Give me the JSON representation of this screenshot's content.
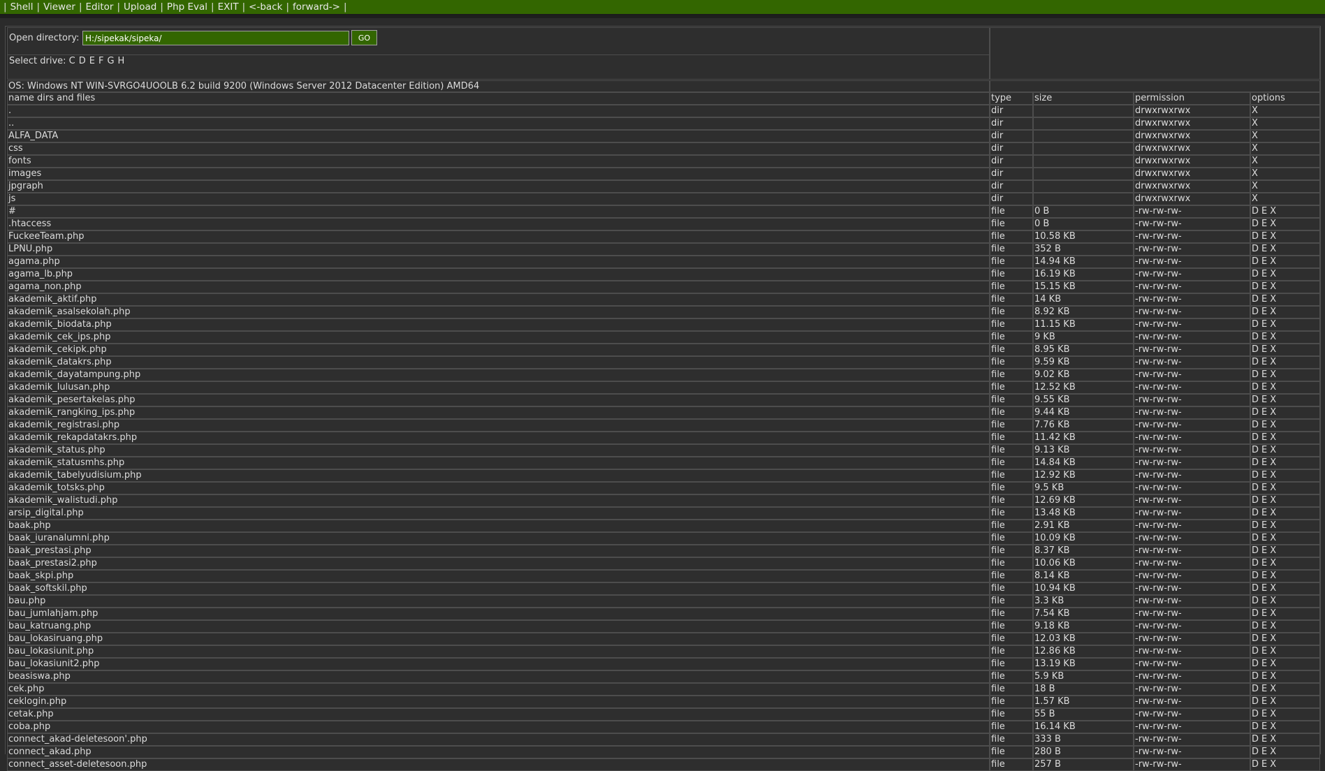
{
  "nav": {
    "items": [
      "Shell",
      "Viewer",
      "Editor",
      "Upload",
      "Php Eval",
      "EXIT",
      "<-back",
      "forward->"
    ]
  },
  "open_directory": {
    "label": "Open directory:",
    "value": "H:/sipekak/sipeka/",
    "go_label": "GO"
  },
  "drives": {
    "label": "Select drive:",
    "letters": [
      "C",
      "D",
      "E",
      "F",
      "G",
      "H"
    ]
  },
  "os_info": "OS: Windows NT WIN-SVRGO4UOOLB 6.2 build 9200 (Windows Server 2012 Datacenter Edition) AMD64",
  "columns": {
    "name": "name dirs and files",
    "type": "type",
    "size": "size",
    "permission": "permission",
    "options": "options"
  },
  "entries": [
    {
      "name": ".",
      "type": "dir",
      "size": "",
      "perm": "drwxrwxrwx",
      "opts": [
        "X"
      ]
    },
    {
      "name": "..",
      "type": "dir",
      "size": "",
      "perm": "drwxrwxrwx",
      "opts": [
        "X"
      ]
    },
    {
      "name": "ALFA_DATA",
      "type": "dir",
      "size": "",
      "perm": "drwxrwxrwx",
      "opts": [
        "X"
      ]
    },
    {
      "name": "css",
      "type": "dir",
      "size": "",
      "perm": "drwxrwxrwx",
      "opts": [
        "X"
      ]
    },
    {
      "name": "fonts",
      "type": "dir",
      "size": "",
      "perm": "drwxrwxrwx",
      "opts": [
        "X"
      ]
    },
    {
      "name": "images",
      "type": "dir",
      "size": "",
      "perm": "drwxrwxrwx",
      "opts": [
        "X"
      ]
    },
    {
      "name": "jpgraph",
      "type": "dir",
      "size": "",
      "perm": "drwxrwxrwx",
      "opts": [
        "X"
      ]
    },
    {
      "name": "js",
      "type": "dir",
      "size": "",
      "perm": "drwxrwxrwx",
      "opts": [
        "X"
      ]
    },
    {
      "name": "#",
      "type": "file",
      "size": "0 B",
      "perm": "-rw-rw-rw-",
      "opts": [
        "D",
        "E",
        "X"
      ]
    },
    {
      "name": ".htaccess",
      "type": "file",
      "size": "0 B",
      "perm": "-rw-rw-rw-",
      "opts": [
        "D",
        "E",
        "X"
      ]
    },
    {
      "name": "FuckeeTeam.php",
      "type": "file",
      "size": "10.58 KB",
      "perm": "-rw-rw-rw-",
      "opts": [
        "D",
        "E",
        "X"
      ]
    },
    {
      "name": "LPNU.php",
      "type": "file",
      "size": "352 B",
      "perm": "-rw-rw-rw-",
      "opts": [
        "D",
        "E",
        "X"
      ]
    },
    {
      "name": "agama.php",
      "type": "file",
      "size": "14.94 KB",
      "perm": "-rw-rw-rw-",
      "opts": [
        "D",
        "E",
        "X"
      ]
    },
    {
      "name": "agama_lb.php",
      "type": "file",
      "size": "16.19 KB",
      "perm": "-rw-rw-rw-",
      "opts": [
        "D",
        "E",
        "X"
      ]
    },
    {
      "name": "agama_non.php",
      "type": "file",
      "size": "15.15 KB",
      "perm": "-rw-rw-rw-",
      "opts": [
        "D",
        "E",
        "X"
      ]
    },
    {
      "name": "akademik_aktif.php",
      "type": "file",
      "size": "14 KB",
      "perm": "-rw-rw-rw-",
      "opts": [
        "D",
        "E",
        "X"
      ]
    },
    {
      "name": "akademik_asalsekolah.php",
      "type": "file",
      "size": "8.92 KB",
      "perm": "-rw-rw-rw-",
      "opts": [
        "D",
        "E",
        "X"
      ]
    },
    {
      "name": "akademik_biodata.php",
      "type": "file",
      "size": "11.15 KB",
      "perm": "-rw-rw-rw-",
      "opts": [
        "D",
        "E",
        "X"
      ]
    },
    {
      "name": "akademik_cek_ips.php",
      "type": "file",
      "size": "9 KB",
      "perm": "-rw-rw-rw-",
      "opts": [
        "D",
        "E",
        "X"
      ]
    },
    {
      "name": "akademik_cekipk.php",
      "type": "file",
      "size": "8.95 KB",
      "perm": "-rw-rw-rw-",
      "opts": [
        "D",
        "E",
        "X"
      ]
    },
    {
      "name": "akademik_datakrs.php",
      "type": "file",
      "size": "9.59 KB",
      "perm": "-rw-rw-rw-",
      "opts": [
        "D",
        "E",
        "X"
      ]
    },
    {
      "name": "akademik_dayatampung.php",
      "type": "file",
      "size": "9.02 KB",
      "perm": "-rw-rw-rw-",
      "opts": [
        "D",
        "E",
        "X"
      ]
    },
    {
      "name": "akademik_lulusan.php",
      "type": "file",
      "size": "12.52 KB",
      "perm": "-rw-rw-rw-",
      "opts": [
        "D",
        "E",
        "X"
      ]
    },
    {
      "name": "akademik_pesertakelas.php",
      "type": "file",
      "size": "9.55 KB",
      "perm": "-rw-rw-rw-",
      "opts": [
        "D",
        "E",
        "X"
      ]
    },
    {
      "name": "akademik_rangking_ips.php",
      "type": "file",
      "size": "9.44 KB",
      "perm": "-rw-rw-rw-",
      "opts": [
        "D",
        "E",
        "X"
      ]
    },
    {
      "name": "akademik_registrasi.php",
      "type": "file",
      "size": "7.76 KB",
      "perm": "-rw-rw-rw-",
      "opts": [
        "D",
        "E",
        "X"
      ]
    },
    {
      "name": "akademik_rekapdatakrs.php",
      "type": "file",
      "size": "11.42 KB",
      "perm": "-rw-rw-rw-",
      "opts": [
        "D",
        "E",
        "X"
      ]
    },
    {
      "name": "akademik_status.php",
      "type": "file",
      "size": "9.13 KB",
      "perm": "-rw-rw-rw-",
      "opts": [
        "D",
        "E",
        "X"
      ]
    },
    {
      "name": "akademik_statusmhs.php",
      "type": "file",
      "size": "14.84 KB",
      "perm": "-rw-rw-rw-",
      "opts": [
        "D",
        "E",
        "X"
      ]
    },
    {
      "name": "akademik_tabelyudisium.php",
      "type": "file",
      "size": "12.92 KB",
      "perm": "-rw-rw-rw-",
      "opts": [
        "D",
        "E",
        "X"
      ]
    },
    {
      "name": "akademik_totsks.php",
      "type": "file",
      "size": "9.5 KB",
      "perm": "-rw-rw-rw-",
      "opts": [
        "D",
        "E",
        "X"
      ]
    },
    {
      "name": "akademik_walistudi.php",
      "type": "file",
      "size": "12.69 KB",
      "perm": "-rw-rw-rw-",
      "opts": [
        "D",
        "E",
        "X"
      ]
    },
    {
      "name": "arsip_digital.php",
      "type": "file",
      "size": "13.48 KB",
      "perm": "-rw-rw-rw-",
      "opts": [
        "D",
        "E",
        "X"
      ]
    },
    {
      "name": "baak.php",
      "type": "file",
      "size": "2.91 KB",
      "perm": "-rw-rw-rw-",
      "opts": [
        "D",
        "E",
        "X"
      ]
    },
    {
      "name": "baak_iuranalumni.php",
      "type": "file",
      "size": "10.09 KB",
      "perm": "-rw-rw-rw-",
      "opts": [
        "D",
        "E",
        "X"
      ]
    },
    {
      "name": "baak_prestasi.php",
      "type": "file",
      "size": "8.37 KB",
      "perm": "-rw-rw-rw-",
      "opts": [
        "D",
        "E",
        "X"
      ]
    },
    {
      "name": "baak_prestasi2.php",
      "type": "file",
      "size": "10.06 KB",
      "perm": "-rw-rw-rw-",
      "opts": [
        "D",
        "E",
        "X"
      ]
    },
    {
      "name": "baak_skpi.php",
      "type": "file",
      "size": "8.14 KB",
      "perm": "-rw-rw-rw-",
      "opts": [
        "D",
        "E",
        "X"
      ]
    },
    {
      "name": "baak_softskil.php",
      "type": "file",
      "size": "10.94 KB",
      "perm": "-rw-rw-rw-",
      "opts": [
        "D",
        "E",
        "X"
      ]
    },
    {
      "name": "bau.php",
      "type": "file",
      "size": "3.3 KB",
      "perm": "-rw-rw-rw-",
      "opts": [
        "D",
        "E",
        "X"
      ]
    },
    {
      "name": "bau_jumlahjam.php",
      "type": "file",
      "size": "7.54 KB",
      "perm": "-rw-rw-rw-",
      "opts": [
        "D",
        "E",
        "X"
      ]
    },
    {
      "name": "bau_katruang.php",
      "type": "file",
      "size": "9.18 KB",
      "perm": "-rw-rw-rw-",
      "opts": [
        "D",
        "E",
        "X"
      ]
    },
    {
      "name": "bau_lokasiruang.php",
      "type": "file",
      "size": "12.03 KB",
      "perm": "-rw-rw-rw-",
      "opts": [
        "D",
        "E",
        "X"
      ]
    },
    {
      "name": "bau_lokasiunit.php",
      "type": "file",
      "size": "12.86 KB",
      "perm": "-rw-rw-rw-",
      "opts": [
        "D",
        "E",
        "X"
      ]
    },
    {
      "name": "bau_lokasiunit2.php",
      "type": "file",
      "size": "13.19 KB",
      "perm": "-rw-rw-rw-",
      "opts": [
        "D",
        "E",
        "X"
      ]
    },
    {
      "name": "beasiswa.php",
      "type": "file",
      "size": "5.9 KB",
      "perm": "-rw-rw-rw-",
      "opts": [
        "D",
        "E",
        "X"
      ]
    },
    {
      "name": "cek.php",
      "type": "file",
      "size": "18 B",
      "perm": "-rw-rw-rw-",
      "opts": [
        "D",
        "E",
        "X"
      ]
    },
    {
      "name": "ceklogin.php",
      "type": "file",
      "size": "1.57 KB",
      "perm": "-rw-rw-rw-",
      "opts": [
        "D",
        "E",
        "X"
      ]
    },
    {
      "name": "cetak.php",
      "type": "file",
      "size": "55 B",
      "perm": "-rw-rw-rw-",
      "opts": [
        "D",
        "E",
        "X"
      ]
    },
    {
      "name": "coba.php",
      "type": "file",
      "size": "16.14 KB",
      "perm": "-rw-rw-rw-",
      "opts": [
        "D",
        "E",
        "X"
      ]
    },
    {
      "name": "connect_akad-deletesoon'.php",
      "type": "file",
      "size": "333 B",
      "perm": "-rw-rw-rw-",
      "opts": [
        "D",
        "E",
        "X"
      ]
    },
    {
      "name": "connect_akad.php",
      "type": "file",
      "size": "280 B",
      "perm": "-rw-rw-rw-",
      "opts": [
        "D",
        "E",
        "X"
      ]
    },
    {
      "name": "connect_asset-deletesoon.php",
      "type": "file",
      "size": "257 B",
      "perm": "-rw-rw-rw-",
      "opts": [
        "D",
        "E",
        "X"
      ]
    }
  ],
  "colors": {
    "accent": "#336600",
    "background": "#2b2b2b",
    "text": "#dcdcdc"
  }
}
